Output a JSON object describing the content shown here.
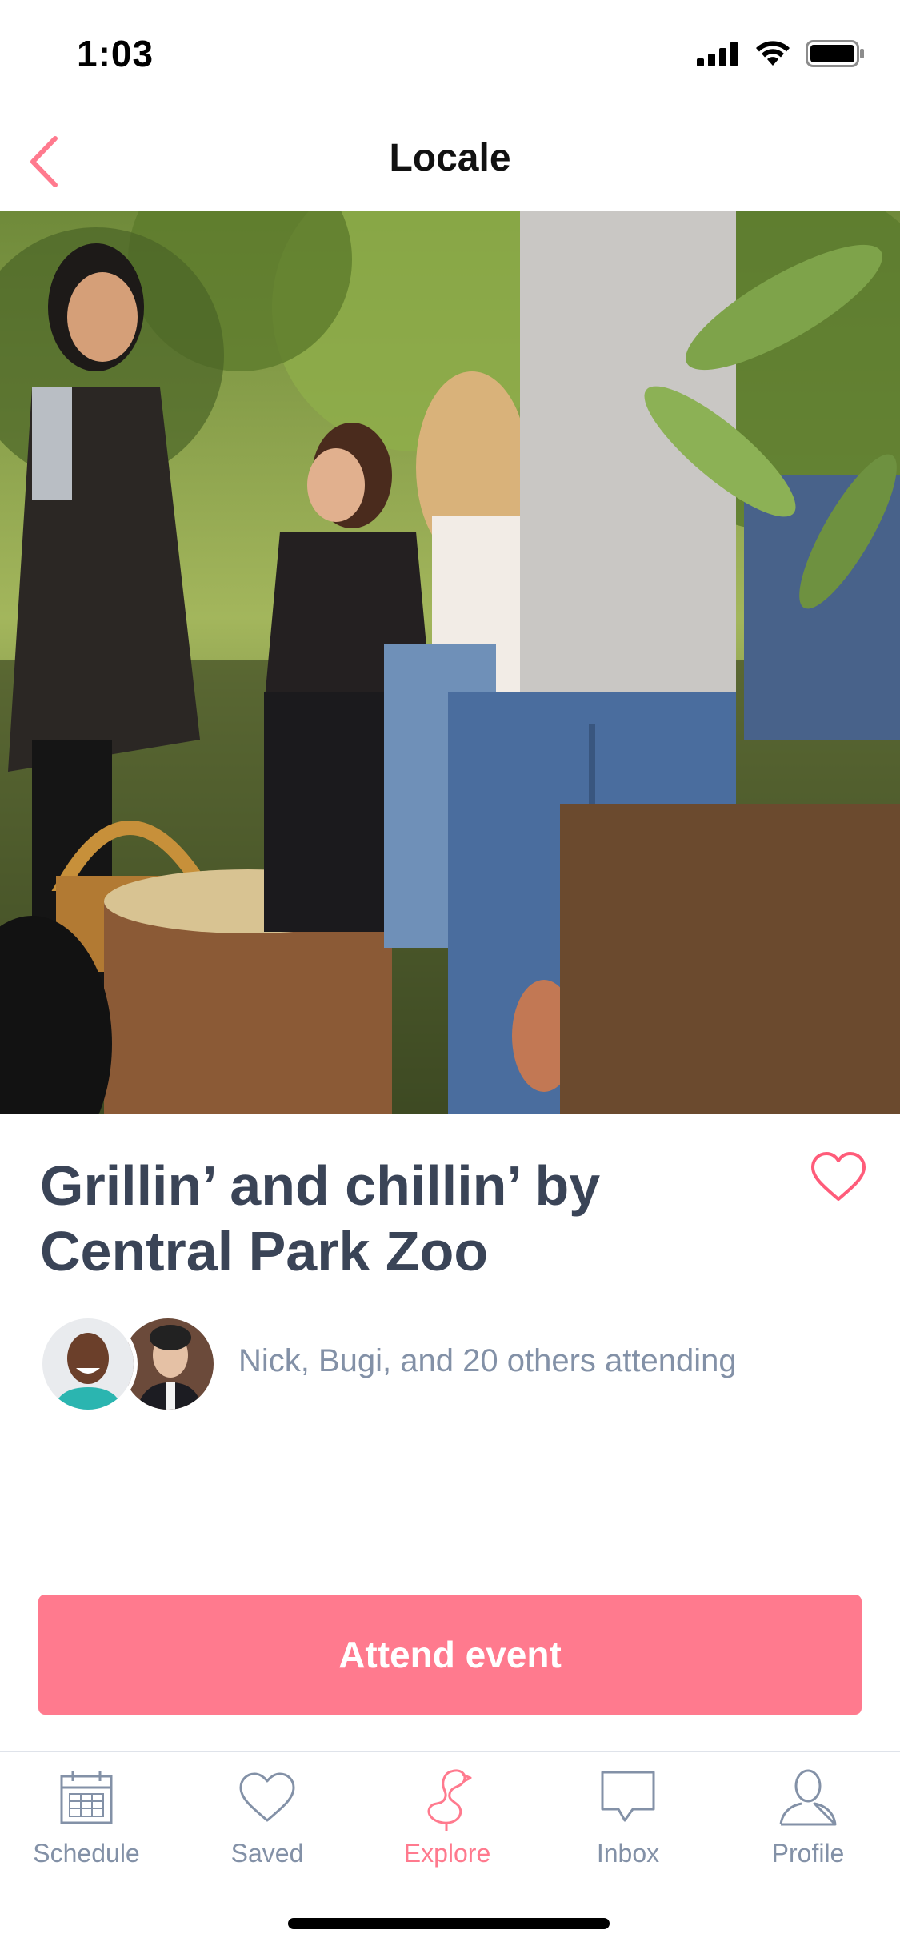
{
  "status_bar": {
    "time": "1:03"
  },
  "nav": {
    "title": "Locale"
  },
  "event": {
    "title": "Grillin’ and chillin’ by Central Park Zoo",
    "attendees_text": "Nick, Bugi, and 20 others attending"
  },
  "actions": {
    "attend_label": "Attend event"
  },
  "tabs": [
    {
      "label": "Schedule",
      "icon": "calendar-icon",
      "active": false
    },
    {
      "label": "Saved",
      "icon": "heart-icon",
      "active": false
    },
    {
      "label": "Explore",
      "icon": "flamingo-icon",
      "active": true
    },
    {
      "label": "Inbox",
      "icon": "chat-bubble-icon",
      "active": false
    },
    {
      "label": "Profile",
      "icon": "person-icon",
      "active": false
    }
  ],
  "colors": {
    "accent": "#ff7a8e",
    "title_text": "#3a4457",
    "secondary_text": "#8391a7",
    "divider": "#dfe3ea"
  }
}
